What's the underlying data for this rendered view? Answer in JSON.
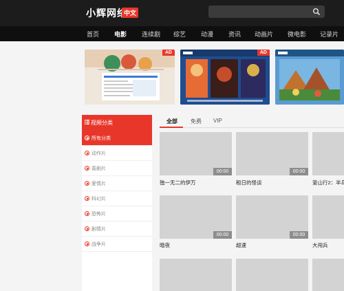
{
  "header": {
    "logo": "小辉网络",
    "logo_badge": "中文",
    "search_placeholder": ""
  },
  "nav": [
    "首页",
    "电影",
    "连续剧",
    "综艺",
    "动漫",
    "资讯",
    "动画片",
    "微电影",
    "记录片"
  ],
  "nav_active_index": 1,
  "banners": [
    {
      "ad": "AD"
    },
    {
      "ad": "AD"
    },
    {
      "ad": ""
    }
  ],
  "sidebar": {
    "title": "视频分类",
    "items": [
      "所有分类",
      "动作片",
      "喜剧片",
      "爱情片",
      "科幻片",
      "恐怖片",
      "剧情片",
      "战争片"
    ],
    "current_index": 0
  },
  "tabs": [
    "全部",
    "免费",
    "VIP"
  ],
  "active_tab": 0,
  "cards": [
    {
      "title": "独一无二的伊万",
      "duration": "00:00"
    },
    {
      "title": "租日的怪谈",
      "duration": "00:00"
    },
    {
      "title": "釜山行2：半岛",
      "duration": "00:00"
    },
    {
      "title": "暗夜",
      "duration": "00:00"
    },
    {
      "title": "超速",
      "duration": "00:00"
    },
    {
      "title": "大闯兵",
      "duration": "00:00"
    },
    {
      "title": "",
      "duration": ""
    },
    {
      "title": "",
      "duration": ""
    },
    {
      "title": "",
      "duration": ""
    }
  ],
  "colors": {
    "accent": "#e8372a",
    "header": "#1c1c1c",
    "nav": "#0f0f0f"
  }
}
